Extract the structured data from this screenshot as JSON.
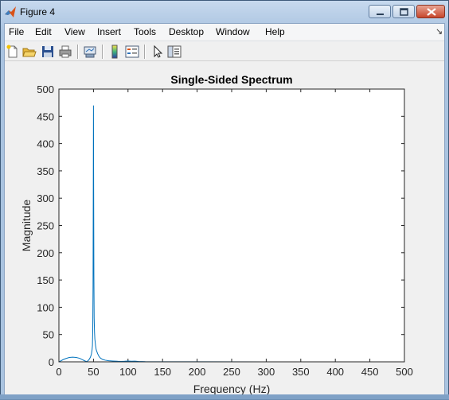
{
  "window": {
    "title": "Figure 4",
    "controls": {
      "minimize": "minimize",
      "maximize": "maximize",
      "close": "close"
    }
  },
  "menubar": {
    "items": [
      "File",
      "Edit",
      "View",
      "Insert",
      "Tools",
      "Desktop",
      "Window",
      "Help"
    ],
    "overflow_icon": "dock-arrow-icon"
  },
  "toolbar": {
    "buttons": [
      {
        "name": "new-figure-button",
        "icon": "new-file-icon"
      },
      {
        "name": "open-file-button",
        "icon": "folder-icon"
      },
      {
        "name": "save-figure-button",
        "icon": "floppy-disk-icon"
      },
      {
        "name": "print-figure-button",
        "icon": "printer-icon"
      },
      {
        "name": "link-plot-button",
        "icon": "link-plot-icon"
      },
      {
        "name": "insert-colorbar-button",
        "icon": "colorbar-icon"
      },
      {
        "name": "insert-legend-button",
        "icon": "legend-icon"
      },
      {
        "name": "edit-plot-button",
        "icon": "pointer-arrow-icon"
      },
      {
        "name": "show-plot-tools-button",
        "icon": "plot-tools-icon"
      }
    ]
  },
  "colors": {
    "line": "#0072bd",
    "axes_background": "#ffffff",
    "figure_background": "#f0f0f0"
  },
  "chart_data": {
    "type": "line",
    "title": "Single-Sided Spectrum",
    "xlabel": "Frequency (Hz)",
    "ylabel": "Magnitude",
    "xlim": [
      0,
      500
    ],
    "ylim": [
      0,
      500
    ],
    "xticks": [
      0,
      50,
      100,
      150,
      200,
      250,
      300,
      350,
      400,
      450,
      500
    ],
    "yticks": [
      0,
      50,
      100,
      150,
      200,
      250,
      300,
      350,
      400,
      450,
      500
    ],
    "grid": false,
    "series": [
      {
        "x": [
          0,
          3,
          6,
          10,
          15,
          20,
          25,
          30,
          34,
          37,
          39,
          40,
          41,
          42,
          43,
          44,
          45,
          46,
          47,
          48,
          48.5,
          49,
          49.4,
          49.8,
          50,
          50.2,
          50.6,
          51,
          51.5,
          52,
          53,
          54,
          56,
          58,
          60,
          63,
          67,
          72,
          78,
          85,
          90,
          95,
          100,
          105,
          110,
          115,
          125,
          150,
          200,
          300,
          400,
          500
        ],
        "y": [
          0,
          2,
          4,
          6,
          8,
          8.5,
          8,
          6.5,
          4,
          2,
          1,
          0.5,
          1,
          2,
          3,
          5,
          7,
          10,
          14,
          22,
          30,
          60,
          140,
          360,
          470,
          360,
          160,
          80,
          55,
          42,
          30,
          22,
          15,
          10,
          7,
          4.5,
          3,
          2,
          1.5,
          1,
          0.8,
          1,
          1.5,
          1,
          1.2,
          0.8,
          0.4,
          0.2,
          0.1,
          0.05,
          0.02,
          0
        ]
      }
    ]
  }
}
